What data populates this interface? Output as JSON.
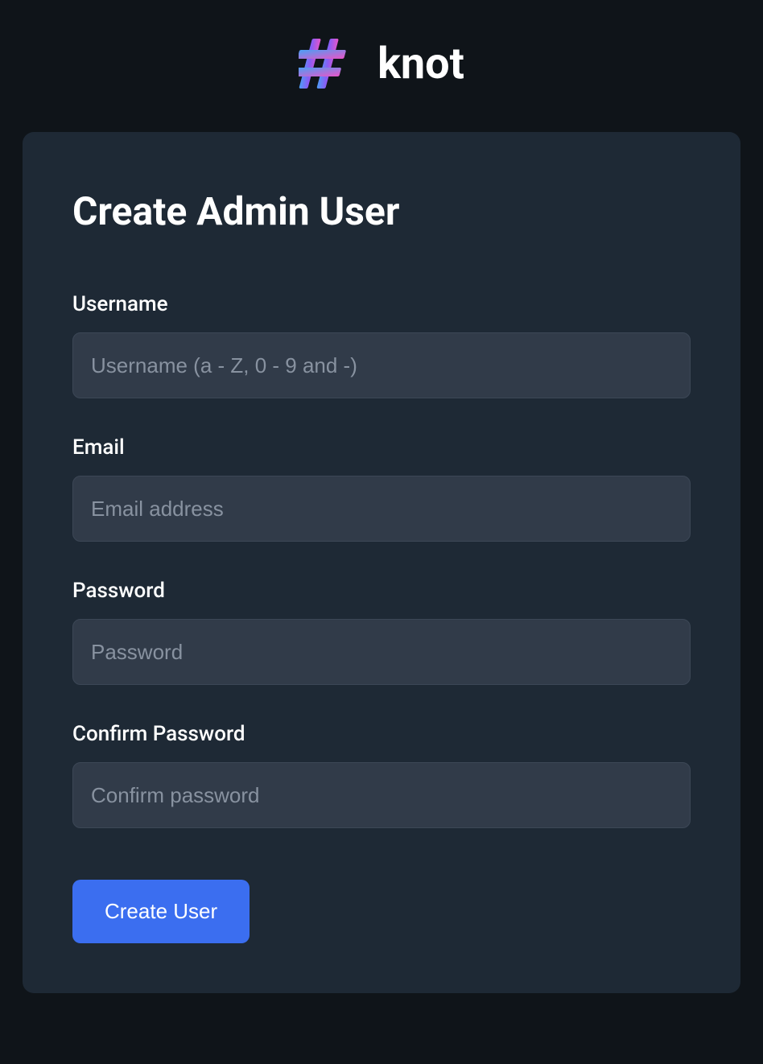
{
  "header": {
    "app_name": "knot"
  },
  "form": {
    "title": "Create Admin User",
    "fields": {
      "username": {
        "label": "Username",
        "placeholder": "Username (a - Z, 0 - 9 and -)"
      },
      "email": {
        "label": "Email",
        "placeholder": "Email address"
      },
      "password": {
        "label": "Password",
        "placeholder": "Password"
      },
      "confirm_password": {
        "label": "Confirm Password",
        "placeholder": "Confirm password"
      }
    },
    "submit_label": "Create User"
  },
  "colors": {
    "background": "#0f1419",
    "card_background": "#1e2935",
    "input_background": "#313b49",
    "input_border": "#3c4756",
    "placeholder": "#8892a0",
    "button": "#3b6ef0",
    "text": "#ffffff"
  }
}
